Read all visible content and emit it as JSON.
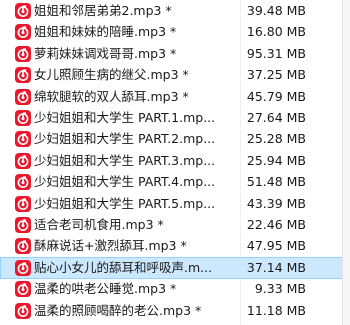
{
  "files": [
    {
      "name": "姐姐和邻居弟弟2.mp3 *",
      "size": "39.48 MB"
    },
    {
      "name": "姐姐和妹妹的陪睡.mp3 *",
      "size": "16.80 MB"
    },
    {
      "name": "萝莉妹妹调戏哥哥.mp3 *",
      "size": "95.31 MB"
    },
    {
      "name": "女儿照顾生病的继父.mp3 *",
      "size": "37.25 MB"
    },
    {
      "name": "绵软腿软的双人舔耳.mp3 *",
      "size": "45.79 MB"
    },
    {
      "name": "少妇姐姐和大学生 PART.1.mp...",
      "size": "27.64 MB"
    },
    {
      "name": "少妇姐姐和大学生 PART.2.mp...",
      "size": "25.28 MB"
    },
    {
      "name": "少妇姐姐和大学生 PART.3.mp...",
      "size": "25.94 MB"
    },
    {
      "name": "少妇姐姐和大学生 PART.4.mp...",
      "size": "51.48 MB"
    },
    {
      "name": "少妇姐姐和大学生 PART.5.mp...",
      "size": "43.39 MB"
    },
    {
      "name": "适合老司机食用.mp3 *",
      "size": "22.46 MB"
    },
    {
      "name": "酥麻说话+激烈舔耳.mp3 *",
      "size": "47.95 MB"
    },
    {
      "name": "贴心小女儿的舔耳和呼吸声.m...",
      "size": "37.14 MB",
      "selected": true
    },
    {
      "name": "温柔的哄老公睡觉.mp3 *",
      "size": "9.33 MB"
    },
    {
      "name": "温柔的照顾喝醉的老公.mp3 *",
      "size": "11.18 MB"
    }
  ],
  "icon": {
    "name": "netease-music-icon",
    "color": "#e8192c"
  }
}
